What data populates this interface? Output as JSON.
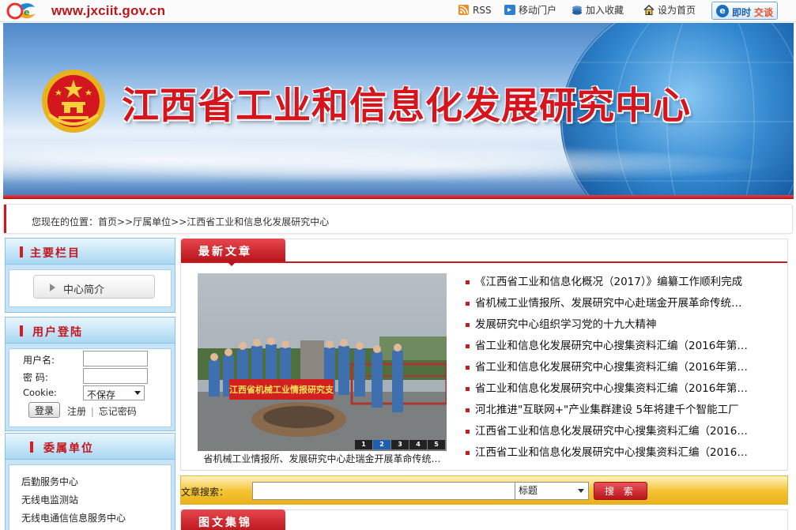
{
  "header": {
    "site_url": "www.jxciit.gov.cn",
    "links": {
      "rss": "RSS",
      "mobile": "移动门户",
      "favorite": "加入收藏",
      "homepage": "设为首页"
    },
    "chat": {
      "part1": "即时",
      "part2": "交谈"
    }
  },
  "banner": {
    "title": "江西省工业和信息化发展研究中心"
  },
  "breadcrumb": {
    "prefix": "您现在的位置：",
    "items": [
      "首页",
      "厅属单位",
      "江西省工业和信息化发展研究中心"
    ],
    "separator": ">>"
  },
  "sidebar": {
    "main": {
      "title": "主要栏目",
      "items": [
        "中心简介"
      ]
    },
    "login": {
      "title": "用户登陆",
      "username_label": "用户名:",
      "password_label": "密 码:",
      "cookie_label": "Cookie:",
      "cookie_option": "不保存",
      "login_button": "登录",
      "register": "注册",
      "divider": "|",
      "forgot": "忘记密码"
    },
    "units": {
      "title": "委属单位",
      "items": [
        "后勤服务中心",
        "无线电监测站",
        "无线电通信信息服务中心"
      ]
    }
  },
  "latest": {
    "tab": "最新文章",
    "photo_caption": "省机械工业情报所、发展研究中心赴瑞金开展革命传统…",
    "photo_banner_text": "江西省机械工业情报研究支部",
    "slides": [
      "1",
      "2",
      "3",
      "4",
      "5"
    ],
    "active_slide": 2,
    "articles": [
      "《江西省工业和信息化概况（2017）》编纂工作顺利完成",
      "省机械工业情报所、发展研究中心赴瑞金开展革命传统…",
      "发展研究中心组织学习党的十九大精神",
      "省工业和信息化发展研究中心搜集资料汇编（2016年第…",
      "省工业和信息化发展研究中心搜集资料汇编（2016年第…",
      "省工业和信息化发展研究中心搜集资料汇编（2016年第…",
      "河北推进\"互联网+\"产业集群建设 5年将建千个智能工厂",
      "江西省工业和信息化发展研究中心搜集资料汇编（2016…",
      "江西省工业和信息化发展研究中心搜集资料汇编（2016…"
    ]
  },
  "search": {
    "label": "文章搜索：",
    "field_value": "",
    "scope": "标题",
    "button": "搜 索"
  },
  "gallery": {
    "tab": "图文集锦"
  },
  "colors": {
    "brand_red": "#c81a1f",
    "sidebar_blue": "#c6e4f6",
    "search_gold": "#f4c230"
  }
}
